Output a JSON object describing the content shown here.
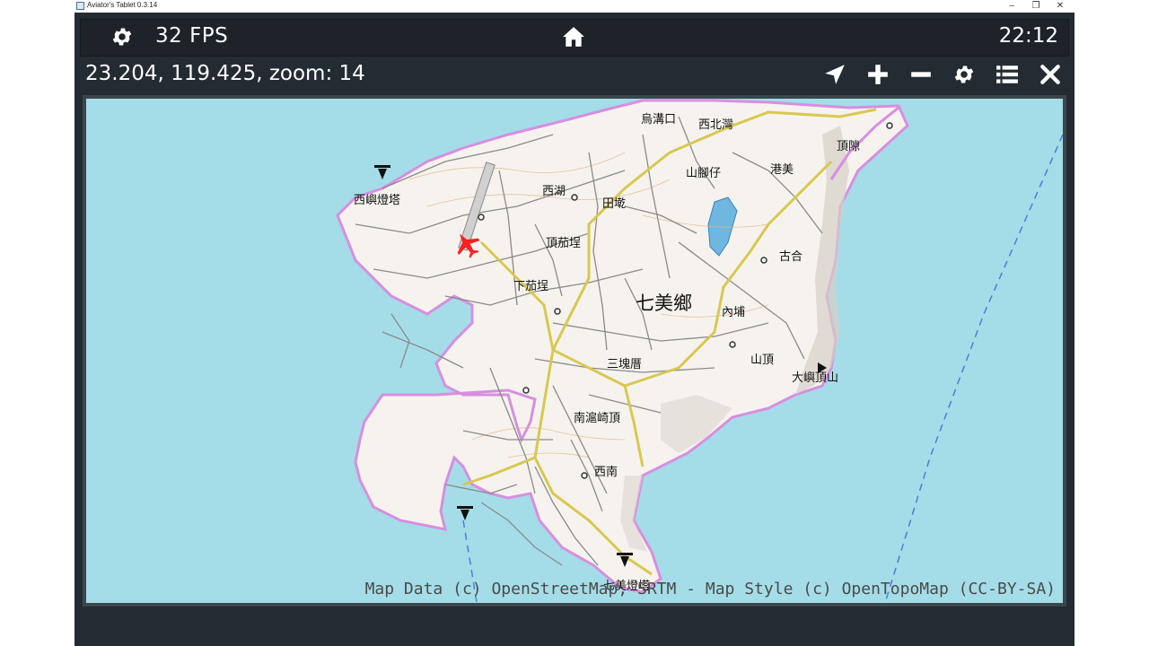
{
  "window": {
    "title": "Aviator's Tablet  0.3.14",
    "controls": {
      "minimize": "‒",
      "restore": "❐",
      "close": "✕"
    }
  },
  "topbar": {
    "fps": "32 FPS",
    "clock": "22:12",
    "icons": {
      "settings": "gear-icon",
      "home": "home-icon"
    }
  },
  "infobar": {
    "coords": "23.204, 119.425, zoom: 14",
    "tools": [
      "locate-arrow-icon",
      "zoom-in-icon",
      "zoom-out-icon",
      "gear-icon",
      "list-icon",
      "close-icon"
    ]
  },
  "map": {
    "attribution": "Map Data (c) OpenStreetMap, SRTM - Map Style (c) OpenTopoMap (CC-BY-SA)",
    "places": [
      "烏溝口",
      "西北灣",
      "頂隙",
      "山腳仔",
      "港美",
      "西湖",
      "田墘",
      "西嶼燈塔",
      "頂茄埕",
      "古合",
      "下茄埕",
      "七美鄉",
      "內埔",
      "三塊厝",
      "山頂",
      "大嶼頂山",
      "南滬崎頂",
      "西南",
      "七美燈塔"
    ],
    "colors": {
      "sea": "#a4dde8",
      "land": "#f6f3ee",
      "road": "#8a8a8a",
      "main_road": "#d8c850",
      "coast": "#d88ee0"
    }
  }
}
